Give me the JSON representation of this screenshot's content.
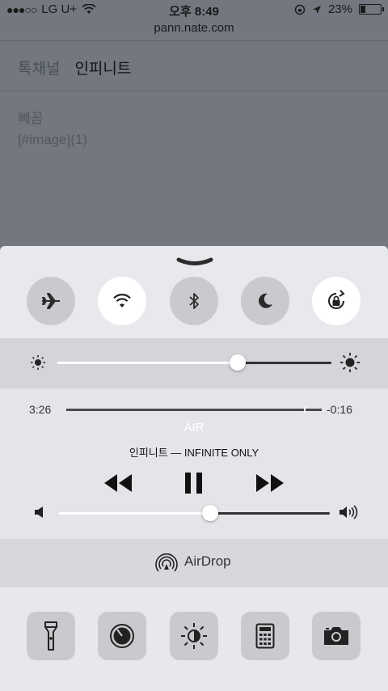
{
  "status_bar": {
    "signal_dots": "●●●○○",
    "carrier": "LG U+",
    "time": "오후 8:49",
    "battery_percent": "23%",
    "battery_level": 0.23
  },
  "browser": {
    "url": "pann.nate.com",
    "tabs": [
      "톡채널",
      "인피니트"
    ],
    "post_title": "빼꼼",
    "post_body": "[#image](1)"
  },
  "control_center": {
    "toggles": [
      {
        "name": "airplane-mode",
        "active": false
      },
      {
        "name": "wifi",
        "active": true
      },
      {
        "name": "bluetooth",
        "active": false
      },
      {
        "name": "do-not-disturb",
        "active": false
      },
      {
        "name": "rotation-lock",
        "active": true
      }
    ],
    "brightness_level": 0.66,
    "music": {
      "elapsed": "3:26",
      "remaining": "-0:16",
      "progress": 0.93,
      "route": "AIR",
      "now_playing": "인피니트 — INFINITE ONLY"
    },
    "volume_level": 0.56,
    "airdrop_label": "AirDrop",
    "shortcuts": [
      "flashlight-icon",
      "timer-icon",
      "night-shift-icon",
      "calculator-icon",
      "camera-icon"
    ]
  },
  "colors": {
    "toggle_on": "#ffffff",
    "toggle_off": "#c9cace",
    "slider_track_filled": "#ffffff",
    "slider_track_empty": "#333333"
  }
}
